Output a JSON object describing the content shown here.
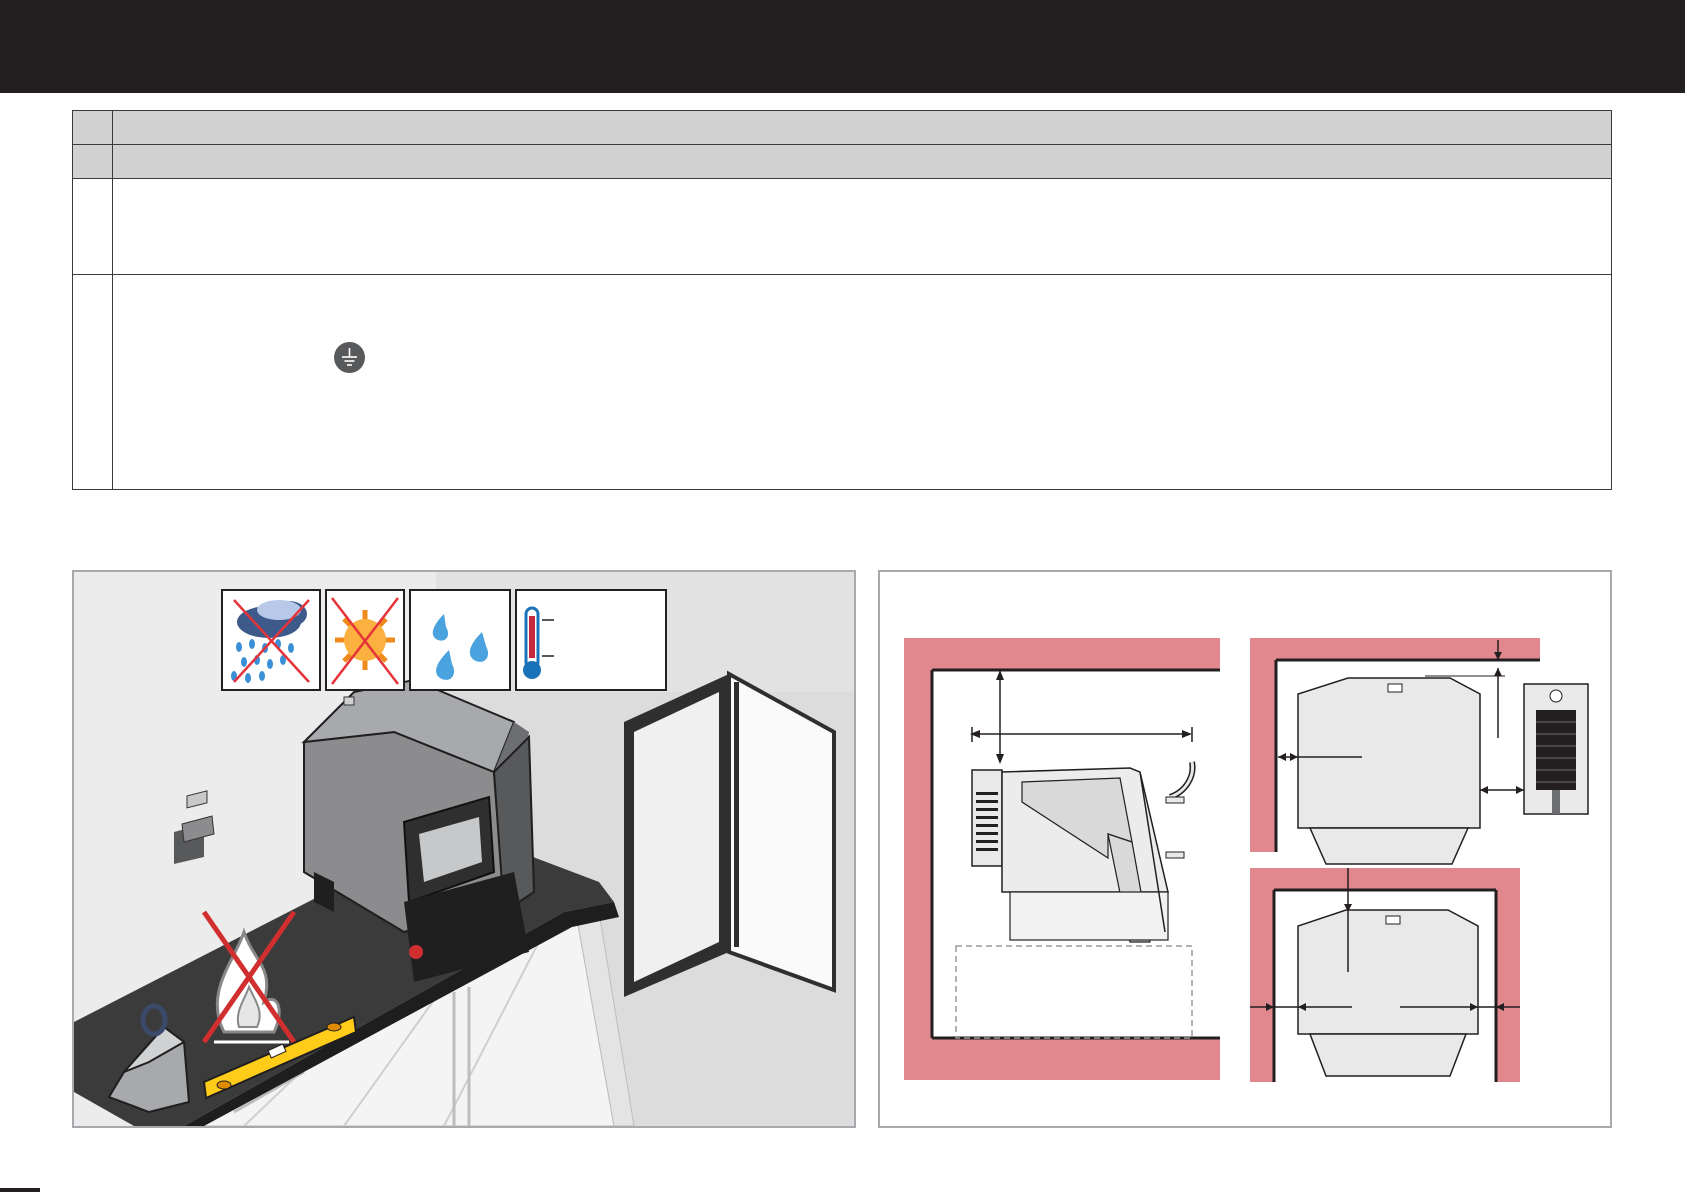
{
  "page": {
    "header_color": "#231f20",
    "table_header_fill": "#d1d1d1",
    "wall_color": "#e0888e"
  },
  "icons": {
    "ground": "ground-symbol-icon",
    "rain": "no-rain-icon",
    "sun": "no-direct-sun-icon",
    "humidity": "humidity-drops-icon",
    "temperature": "thermometer-icon",
    "fire": "no-flame-icon",
    "weight": "weight-icon",
    "level": "spirit-level-icon"
  }
}
